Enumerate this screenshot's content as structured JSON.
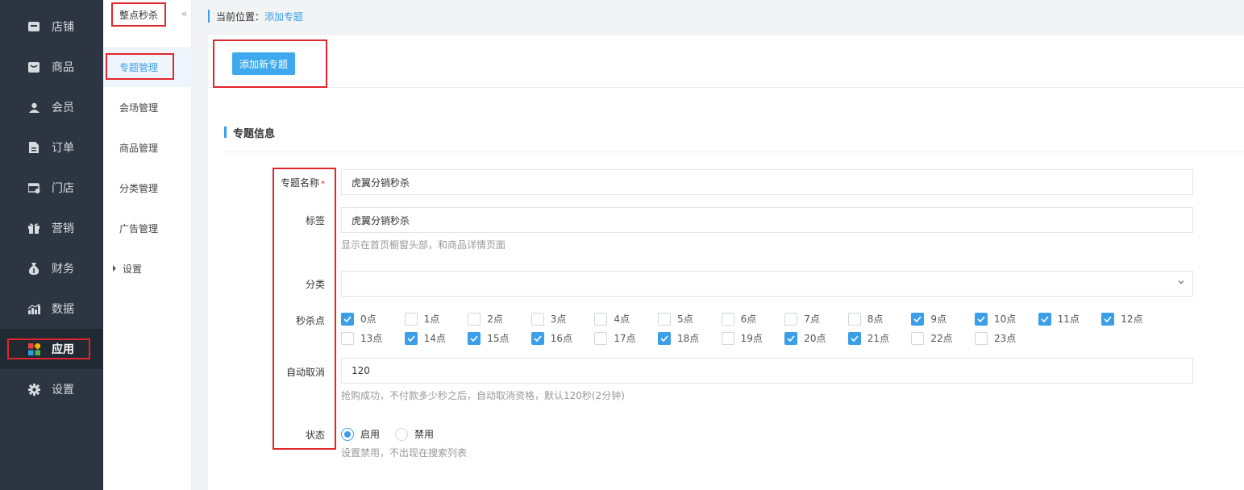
{
  "sidebar": {
    "items": [
      {
        "label": "店铺",
        "icon": "store-icon"
      },
      {
        "label": "商品",
        "icon": "goods-icon"
      },
      {
        "label": "会员",
        "icon": "member-icon"
      },
      {
        "label": "订单",
        "icon": "order-icon"
      },
      {
        "label": "门店",
        "icon": "shop-icon"
      },
      {
        "label": "营销",
        "icon": "gift-icon"
      },
      {
        "label": "财务",
        "icon": "finance-icon"
      },
      {
        "label": "数据",
        "icon": "chart-icon"
      },
      {
        "label": "应用",
        "icon": "apps-icon",
        "active": true
      },
      {
        "label": "设置",
        "icon": "gear-icon"
      }
    ]
  },
  "subnav": {
    "title": "整点秒杀",
    "collapse": "«",
    "items": [
      {
        "label": "专题管理",
        "active": true
      },
      {
        "label": "会场管理"
      },
      {
        "label": "商品管理"
      },
      {
        "label": "分类管理"
      },
      {
        "label": "广告管理"
      },
      {
        "label": "设置"
      }
    ]
  },
  "breadcrumb": {
    "prefix": "当前位置：",
    "current": "添加专题"
  },
  "toolbar": {
    "add_label": "添加新专题"
  },
  "section": {
    "title": "专题信息"
  },
  "form": {
    "name": {
      "label": "专题名称",
      "required": "*",
      "value": "虎翼分销秒杀"
    },
    "tag": {
      "label": "标签",
      "value": "虎翼分销秒杀",
      "hint": "显示在首页橱窗头部，和商品详情页面"
    },
    "category": {
      "label": "分类",
      "value": ""
    },
    "points": {
      "label": "秒杀点",
      "options": [
        {
          "label": "0点",
          "checked": true
        },
        {
          "label": "1点",
          "checked": false
        },
        {
          "label": "2点",
          "checked": false
        },
        {
          "label": "3点",
          "checked": false
        },
        {
          "label": "4点",
          "checked": false
        },
        {
          "label": "5点",
          "checked": false
        },
        {
          "label": "6点",
          "checked": false
        },
        {
          "label": "7点",
          "checked": false
        },
        {
          "label": "8点",
          "checked": false
        },
        {
          "label": "9点",
          "checked": true
        },
        {
          "label": "10点",
          "checked": true
        },
        {
          "label": "11点",
          "checked": true
        },
        {
          "label": "12点",
          "checked": true
        },
        {
          "label": "13点",
          "checked": false
        },
        {
          "label": "14点",
          "checked": true
        },
        {
          "label": "15点",
          "checked": true
        },
        {
          "label": "16点",
          "checked": true
        },
        {
          "label": "17点",
          "checked": false
        },
        {
          "label": "18点",
          "checked": true
        },
        {
          "label": "19点",
          "checked": false
        },
        {
          "label": "20点",
          "checked": true
        },
        {
          "label": "21点",
          "checked": true
        },
        {
          "label": "22点",
          "checked": false
        },
        {
          "label": "23点",
          "checked": false
        }
      ]
    },
    "autocancel": {
      "label": "自动取消",
      "value": "120",
      "hint": "抢购成功，不付款多少秒之后，自动取消资格，默认120秒(2分钟)"
    },
    "status": {
      "label": "状态",
      "on_label": "启用",
      "off_label": "禁用",
      "selected": "on",
      "hint": "设置禁用，不出现在搜索列表"
    }
  },
  "colors": {
    "accent": "#3a9fe8",
    "sidebar_bg": "#2c3541",
    "highlight": "#e0262c"
  }
}
